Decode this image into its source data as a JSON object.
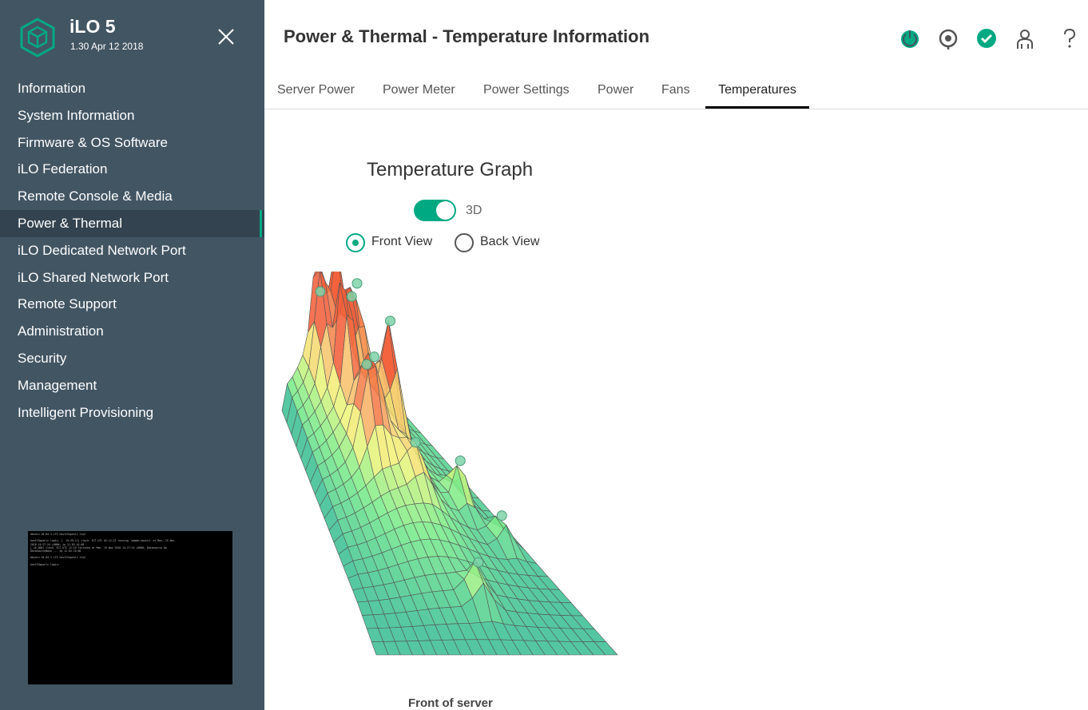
{
  "app": {
    "name": "iLO 5",
    "version": "1.30 Apr 12 2018"
  },
  "sidebar": {
    "items": [
      {
        "label": "Information",
        "name": "sidebar-item-information",
        "active": false
      },
      {
        "label": "System Information",
        "name": "sidebar-item-system-information",
        "active": false
      },
      {
        "label": "Firmware & OS Software",
        "name": "sidebar-item-firmware-os-software",
        "active": false
      },
      {
        "label": "iLO Federation",
        "name": "sidebar-item-ilo-federation",
        "active": false
      },
      {
        "label": "Remote Console & Media",
        "name": "sidebar-item-remote-console-media",
        "active": false
      },
      {
        "label": "Power & Thermal",
        "name": "sidebar-item-power-thermal",
        "active": true
      },
      {
        "label": "iLO Dedicated Network Port",
        "name": "sidebar-item-ilo-dedicated-network-port",
        "active": false
      },
      {
        "label": "iLO Shared Network Port",
        "name": "sidebar-item-ilo-shared-network-port",
        "active": false
      },
      {
        "label": "Remote Support",
        "name": "sidebar-item-remote-support",
        "active": false
      },
      {
        "label": "Administration",
        "name": "sidebar-item-administration",
        "active": false
      },
      {
        "label": "Security",
        "name": "sidebar-item-security",
        "active": false
      },
      {
        "label": "Management",
        "name": "sidebar-item-management",
        "active": false
      },
      {
        "label": "Intelligent Provisioning",
        "name": "sidebar-item-intelligent-provisioning",
        "active": false
      }
    ],
    "console_preview_text": "Ubuntu 18.04.1 LTS host23openlc ttyS\n\nhost23openlc login: [  15:39:11] clock: ECT-UTC 02:12:22 running 'mdadm.ubuntu' at Mon, 19 Nov\n2018 14:27:24 +0000; ip 12.03.10.00\n[ 16.000] clock: ECT-UTC 12:10 finished at Mon, 19 Nov 2018 14:27:24 +0000; Datasource Da\nDataSourceNone ... ip 12.03.10.00\n\nUbuntu 18.04.1 LTS host23openlc ttyS\n\nhost23openlc login:"
  },
  "header": {
    "title": "Power & Thermal - Temperature Information",
    "icons": [
      "power-status-icon",
      "locator-icon",
      "health-ok-icon",
      "user-icon",
      "help-icon"
    ],
    "power_status_color": "#01a982",
    "health_color": "#01a982"
  },
  "tabs": [
    {
      "label": "Server Power",
      "name": "tab-server-power",
      "active": false
    },
    {
      "label": "Power Meter",
      "name": "tab-power-meter",
      "active": false
    },
    {
      "label": "Power Settings",
      "name": "tab-power-settings",
      "active": false
    },
    {
      "label": "Power",
      "name": "tab-power",
      "active": false
    },
    {
      "label": "Fans",
      "name": "tab-fans",
      "active": false
    },
    {
      "label": "Temperatures",
      "name": "tab-temperatures",
      "active": true
    }
  ],
  "graph": {
    "title": "Temperature Graph",
    "toggle_3d": {
      "label": "3D",
      "on": true
    },
    "views": [
      {
        "label": "Front View",
        "selected": true
      },
      {
        "label": "Back View",
        "selected": false
      }
    ],
    "caption": "Front of server",
    "accent_color": "#01a982",
    "color_scale": [
      "#3cbf95",
      "#7bec8a",
      "#f2f57a",
      "#f8b86a",
      "#f2603a"
    ]
  }
}
